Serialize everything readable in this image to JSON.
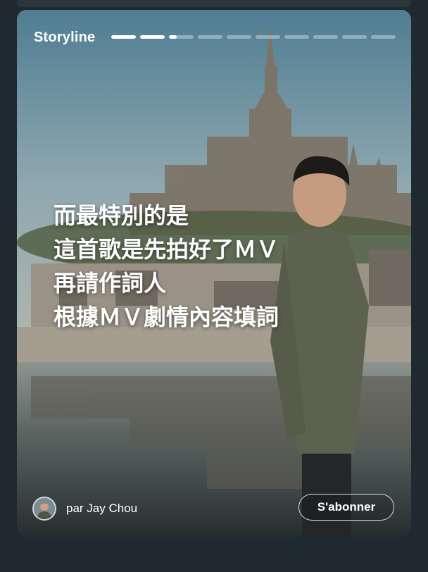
{
  "story": {
    "title": "Storyline",
    "progress": {
      "total_segments": 10,
      "current_index": 2,
      "current_fraction": 0.3
    },
    "lyrics": [
      "而最特別的是",
      "這首歌是先拍好了ＭＶ",
      "再請作詞人",
      "根據ＭＶ劇情內容填詞"
    ],
    "author_label": "par Jay Chou",
    "subscribe_label": "S'abonner"
  },
  "colors": {
    "background": "#1f2a30",
    "text": "#ffffff",
    "progress_active": "#ffffff",
    "progress_inactive": "rgba(255,255,255,0.35)"
  },
  "icons": {
    "avatar": "user-avatar"
  }
}
